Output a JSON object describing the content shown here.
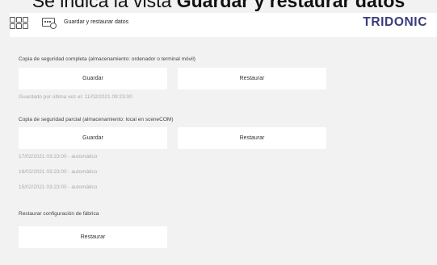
{
  "caption": {
    "prefix": "Se indica la vista",
    "bold": "Guardar y restaurar datos"
  },
  "header": {
    "title": "Guardar y restaurar datos",
    "logo": "TRIDONIC",
    "logo_color": "#3a3b7c"
  },
  "full_backup": {
    "label": "Copia de seguridad completa (almacenamiento: ordenador o terminal móvil)",
    "save_label": "Guardar",
    "restore_label": "Restaurar",
    "last_saved": "Guardado por última vez el: 11/02/2021 09:23:00"
  },
  "partial_backup": {
    "label": "Copia de seguridad parcial (almacenamiento: local en sceneCOM)",
    "save_label": "Guardar",
    "restore_label": "Restaurar",
    "entries": [
      "17/02/2021 03:23:00 - automático",
      "16/02/2021 03:23:00 - automático",
      "15/02/2021 03:23:00 - automático"
    ]
  },
  "factory_reset": {
    "label": "Restaurar configuración de fábrica",
    "restore_label": "Restaurar"
  },
  "icons": [
    "grid-menu-icon",
    "device-settings-icon"
  ]
}
